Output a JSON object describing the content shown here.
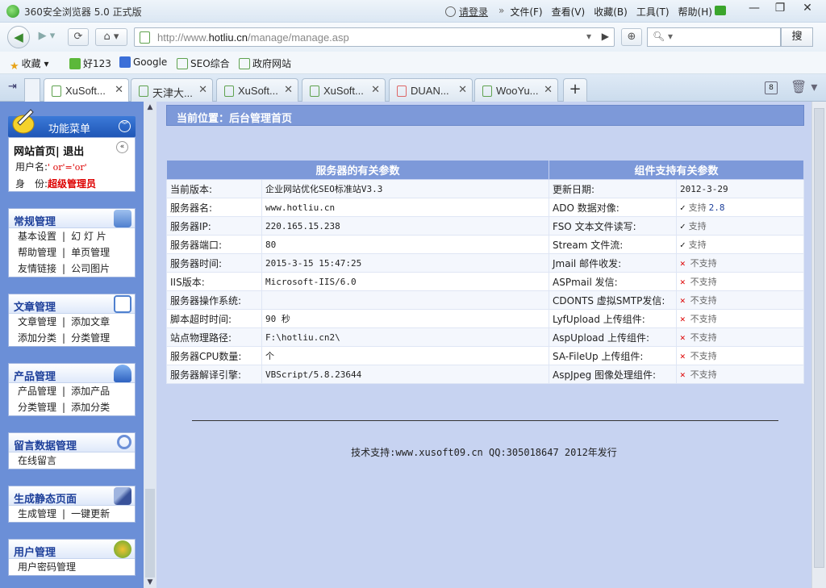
{
  "browser": {
    "title": "360安全浏览器 5.0 正式版",
    "login": "请登录",
    "menus": [
      "文件(F)",
      "查看(V)",
      "收藏(B)",
      "工具(T)",
      "帮助(H)"
    ],
    "url_prefix": "http://www.",
    "url_domain": "hotliu.cn",
    "url_path": "/manage/manage.asp",
    "search_button": "搜",
    "favorites": [
      "收藏",
      "好123",
      "Google",
      "SEO综合",
      "政府网站"
    ],
    "tabs": [
      {
        "label": "XuSoft..."
      },
      {
        "label": "天津大..."
      },
      {
        "label": "XuSoft..."
      },
      {
        "label": "XuSoft..."
      },
      {
        "label": "DUAN..."
      },
      {
        "label": "WooYu..."
      }
    ],
    "tab_count_badge": "8"
  },
  "sidebar": {
    "menu_title": "功能菜单",
    "home_link": "网站首页",
    "logout_link": "退出",
    "username_label": "用户名:",
    "username_value": "' or'='or'",
    "role_label": "身　份:",
    "role_value": "超级管理员",
    "groups": [
      {
        "title": "常规管理",
        "rows": [
          [
            "基本设置",
            "幻 灯 片"
          ],
          [
            "帮助管理",
            "单页管理"
          ],
          [
            "友情链接",
            "公司图片"
          ]
        ]
      },
      {
        "title": "文章管理",
        "rows": [
          [
            "文章管理",
            "添加文章"
          ],
          [
            "添加分类",
            "分类管理"
          ]
        ]
      },
      {
        "title": "产品管理",
        "rows": [
          [
            "产品管理",
            "添加产品"
          ],
          [
            "分类管理",
            "添加分类"
          ]
        ]
      },
      {
        "title": "留言数据管理",
        "rows": [
          [
            "在线留言"
          ]
        ]
      },
      {
        "title": "生成静态页面",
        "rows": [
          [
            "生成管理",
            "一键更新"
          ]
        ]
      },
      {
        "title": "用户管理",
        "rows": [
          [
            "用户密码管理"
          ]
        ]
      }
    ]
  },
  "main": {
    "breadcrumb": "当前位置：后台管理首页",
    "server_header": "服务器的有关参数",
    "component_header": "组件支持有关参数",
    "rows": [
      {
        "k1": "当前版本:",
        "v1": "企业网站优化SEO标准站V3.3",
        "k2": "更新日期:",
        "v2": "2012-3-29",
        "s": ""
      },
      {
        "k1": "服务器名:",
        "v1": "www.hotliu.cn",
        "k2": "ADO 数据对像:",
        "v2": "支持",
        "s": "ok",
        "ver": "2.8"
      },
      {
        "k1": "服务器IP:",
        "v1": "220.165.15.238",
        "k2": "FSO 文本文件读写:",
        "v2": "支持",
        "s": "ok"
      },
      {
        "k1": "服务器端口:",
        "v1": "80",
        "k2": "Stream 文件流:",
        "v2": "支持",
        "s": "ok"
      },
      {
        "k1": "服务器时间:",
        "v1": "2015-3-15 15:47:25",
        "k2": "Jmail 邮件收发:",
        "v2": "不支持",
        "s": "no"
      },
      {
        "k1": "IIS版本:",
        "v1": "Microsoft-IIS/6.0",
        "k2": "ASPmail 发信:",
        "v2": "不支持",
        "s": "no"
      },
      {
        "k1": "服务器操作系统:",
        "v1": "",
        "k2": "CDONTS 虚拟SMTP发信:",
        "v2": "不支持",
        "s": "no"
      },
      {
        "k1": "脚本超时时间:",
        "v1": "90 秒",
        "k2": "LyfUpload 上传组件:",
        "v2": "不支持",
        "s": "no"
      },
      {
        "k1": "站点物理路径:",
        "v1": "F:\\hotliu.cn2\\",
        "k2": "AspUpload 上传组件:",
        "v2": "不支持",
        "s": "no"
      },
      {
        "k1": "服务器CPU数量:",
        "v1": "个",
        "k2": "SA-FileUp 上传组件:",
        "v2": "不支持",
        "s": "no"
      },
      {
        "k1": "服务器解译引擎:",
        "v1": "VBScript/5.8.23644",
        "k2": "AspJpeg 图像处理组件:",
        "v2": "不支持",
        "s": "no"
      }
    ],
    "footer": "技术支持:www.xusoft09.cn QQ:305018647 2012年发行"
  }
}
